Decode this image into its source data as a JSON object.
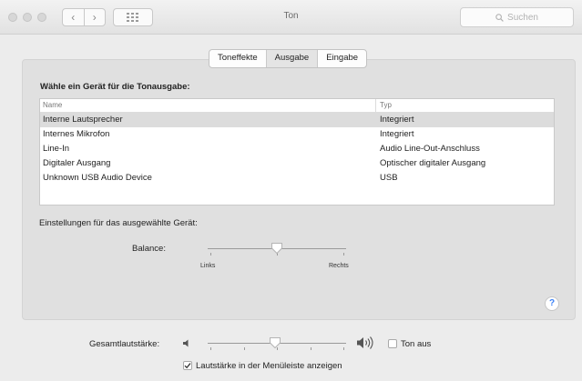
{
  "window": {
    "title": "Ton"
  },
  "toolbar": {
    "search_placeholder": "Suchen",
    "back_glyph": "‹",
    "forward_glyph": "›"
  },
  "tabs": [
    {
      "label": "Toneffekte",
      "active": false
    },
    {
      "label": "Ausgabe",
      "active": true
    },
    {
      "label": "Eingabe",
      "active": false
    }
  ],
  "output": {
    "heading": "Wähle ein Gerät für die Tonausgabe:",
    "columns": [
      "Name",
      "Typ"
    ],
    "devices": [
      {
        "name": "Interne Lautsprecher",
        "type": "Integriert",
        "selected": true
      },
      {
        "name": "Internes Mikrofon",
        "type": "Integriert",
        "selected": false
      },
      {
        "name": "Line-In",
        "type": "Audio Line-Out-Anschluss",
        "selected": false
      },
      {
        "name": "Digitaler Ausgang",
        "type": "Optischer digitaler Ausgang",
        "selected": false
      },
      {
        "name": "Unknown USB Audio Device",
        "type": "USB",
        "selected": false
      }
    ]
  },
  "device_settings": {
    "label": "Einstellungen für das ausgewählte Gerät:",
    "balance_label": "Balance:",
    "left_label": "Links",
    "right_label": "Rechts",
    "balance_value": 0.5
  },
  "help_glyph": "?",
  "volume": {
    "label": "Gesamtlautstärke:",
    "level": 0.49,
    "mute_label": "Ton aus",
    "mute_checked": false,
    "menubar_label": "Lautstärke in der Menüleiste anzeigen",
    "menubar_checked": true
  }
}
